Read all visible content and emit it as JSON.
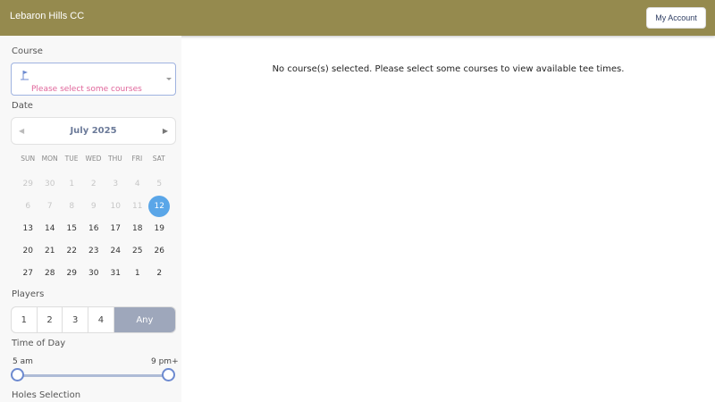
{
  "header": {
    "club_name": "Lebaron Hills CC",
    "account_label": "My Account",
    "bg_color": "#958a4e"
  },
  "sidebar": {
    "course": {
      "label": "Course",
      "placeholder": "Please select some courses",
      "icon": "flag-icon"
    },
    "date": {
      "label": "Date",
      "month_title": "July 2025",
      "prev_icon": "chevron-left-icon",
      "next_icon": "chevron-right-icon",
      "weekdays": [
        "SUN",
        "MON",
        "TUE",
        "WED",
        "THU",
        "FRI",
        "SAT"
      ],
      "days": [
        {
          "d": "29",
          "muted": true
        },
        {
          "d": "30",
          "muted": true
        },
        {
          "d": "1",
          "muted": true
        },
        {
          "d": "2",
          "muted": true
        },
        {
          "d": "3",
          "muted": true
        },
        {
          "d": "4",
          "muted": true
        },
        {
          "d": "5",
          "muted": true
        },
        {
          "d": "6",
          "muted": true
        },
        {
          "d": "7",
          "muted": true
        },
        {
          "d": "8",
          "muted": true
        },
        {
          "d": "9",
          "muted": true
        },
        {
          "d": "10",
          "muted": true
        },
        {
          "d": "11",
          "muted": true
        },
        {
          "d": "12",
          "selected": true
        },
        {
          "d": "13"
        },
        {
          "d": "14"
        },
        {
          "d": "15"
        },
        {
          "d": "16"
        },
        {
          "d": "17"
        },
        {
          "d": "18"
        },
        {
          "d": "19"
        },
        {
          "d": "20"
        },
        {
          "d": "21"
        },
        {
          "d": "22"
        },
        {
          "d": "23"
        },
        {
          "d": "24"
        },
        {
          "d": "25"
        },
        {
          "d": "26"
        },
        {
          "d": "27"
        },
        {
          "d": "28"
        },
        {
          "d": "29"
        },
        {
          "d": "30"
        },
        {
          "d": "31"
        },
        {
          "d": "1"
        },
        {
          "d": "2"
        }
      ],
      "selected_color": "#5aa6e8"
    },
    "players": {
      "label": "Players",
      "options": [
        "1",
        "2",
        "3",
        "4"
      ],
      "any_label": "Any"
    },
    "time_of_day": {
      "label": "Time of Day",
      "min_label": "5 am",
      "max_label": "9 pm+"
    },
    "holes": {
      "label": "Holes Selection"
    }
  },
  "main": {
    "message": "No course(s) selected. Please select some courses to view available tee times."
  }
}
